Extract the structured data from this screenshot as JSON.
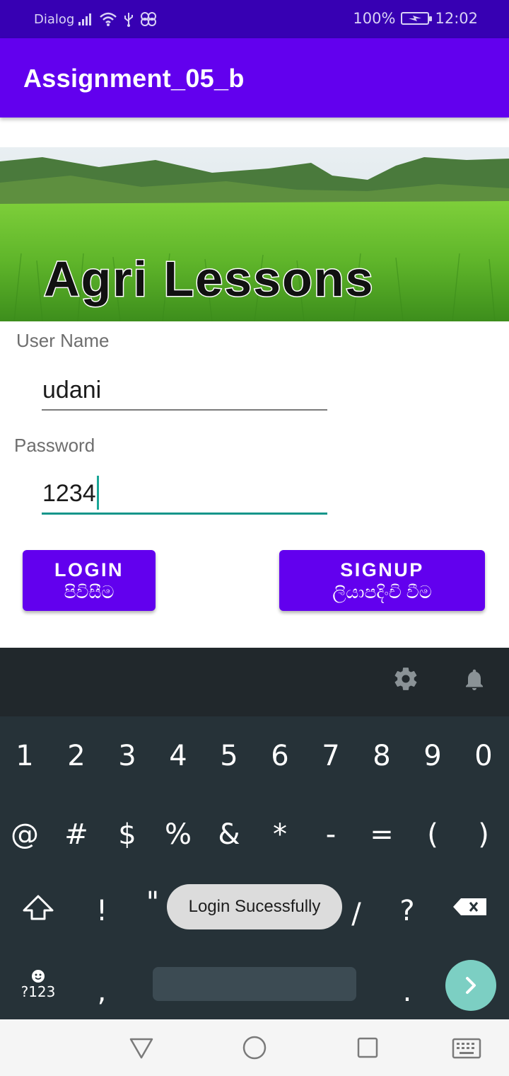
{
  "status_bar": {
    "carrier": "Dialog",
    "battery_percent": "100%",
    "time": "12:02"
  },
  "app_bar": {
    "title": "Assignment_05_b"
  },
  "banner": {
    "text": "Agri Lessons"
  },
  "form": {
    "username_label": "User Name",
    "username_value": "udani",
    "password_label": "Password",
    "password_value": "1234"
  },
  "buttons": {
    "login_en": "LOGIN",
    "login_si": "පිවිසීම",
    "signup_en": "SIGNUP",
    "signup_si": "ලියාපදිංචි වීම"
  },
  "keyboard": {
    "row1": [
      "1",
      "2",
      "3",
      "4",
      "5",
      "6",
      "7",
      "8",
      "9",
      "0"
    ],
    "row2": [
      "@",
      "#",
      "$",
      "%",
      "&",
      "*",
      "-",
      "=",
      "(",
      ")"
    ],
    "row3": [
      "!",
      "\"",
      "'",
      ":",
      ";",
      "/",
      "?"
    ],
    "row4_comma": ",",
    "row4_period": ".",
    "symbols_label": "?123",
    "icons": [
      "gear-icon",
      "bell-icon",
      "shift-icon",
      "backspace-icon",
      "emoji-icon",
      "chevron-right-icon"
    ]
  },
  "toast": {
    "message": "Login Sucessfully"
  },
  "nav_bar": {
    "icons": [
      "back-triangle-icon",
      "home-circle-icon",
      "recents-square-icon",
      "keyboard-icon"
    ]
  },
  "colors": {
    "primary": "#6200ee",
    "primary_dark": "#3700b3",
    "accent": "#03dac5",
    "keyboard_bg": "#263238"
  }
}
